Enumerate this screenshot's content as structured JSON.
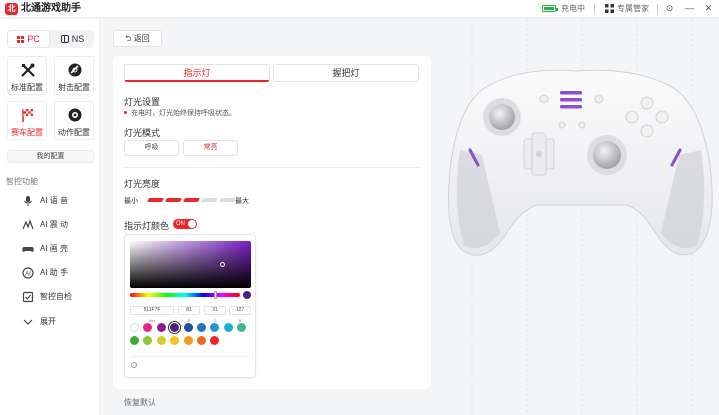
{
  "titlebar": {
    "app_title": "北通游戏助手",
    "logo_glyph": "北",
    "battery_status": "充电中",
    "butler_label": "专属管家",
    "settings_glyph": "⊙",
    "minimize_glyph": "—",
    "close_glyph": "✕"
  },
  "sidebar": {
    "platform_tabs": [
      {
        "label": "PC",
        "active": true
      },
      {
        "label": "NS",
        "active": false
      }
    ],
    "modes": [
      {
        "label": "标准配置",
        "active": false
      },
      {
        "label": "射击配置",
        "active": false
      },
      {
        "label": "赛车配置",
        "active": true
      },
      {
        "label": "动作配置",
        "active": false
      }
    ],
    "my_config_label": "我的配置",
    "smart_section_title": "智控功能",
    "features": [
      {
        "label": "AI 语 音"
      },
      {
        "label": "AI 震 动"
      },
      {
        "label": "AI 画 壳"
      },
      {
        "label": "AI 助 手"
      },
      {
        "label": "智控自检"
      },
      {
        "label": "展开"
      }
    ]
  },
  "back_label": "返回",
  "light_tabs": [
    {
      "label": "指示灯",
      "active": true
    },
    {
      "label": "握把灯",
      "active": false
    }
  ],
  "light_settings": {
    "title": "灯光设置",
    "hint": "充电时，灯光始终保持呼吸状态。",
    "mode_title": "灯光模式",
    "modes": [
      {
        "label": "呼吸",
        "active": false
      },
      {
        "label": "常亮",
        "active": true
      }
    ],
    "brightness_title": "灯光亮度",
    "brightness_min": "最小",
    "brightness_max": "最大",
    "brightness_level": 3,
    "brightness_steps": 5,
    "color_title": "指示灯颜色",
    "color_toggle_label": "ON",
    "color_toggle_on": true
  },
  "color_picker": {
    "hex": "511F7F",
    "r": "81",
    "g": "31",
    "b": "127",
    "hex_label": "Hex",
    "r_label": "R",
    "g_label": "G",
    "b_label": "B",
    "hue_position": 0.77,
    "swatches_row1": [
      "#ffffff",
      "#e8268a",
      "#8e1e8e",
      "#511f7f",
      "#1e4fa3",
      "#2173c9",
      "#2496d6",
      "#19b0d8",
      "#3bb88a"
    ],
    "swatches_row2": [
      "#45a83a",
      "#8cc63f",
      "#c9d12a",
      "#f5c518",
      "#f39a1c",
      "#ee6a1f",
      "#e8262c"
    ]
  },
  "reset_label": "恢复默认",
  "colors": {
    "accent": "#e8262c",
    "selected_color": "#511f7f",
    "controller_light": "#8a4fcf"
  }
}
